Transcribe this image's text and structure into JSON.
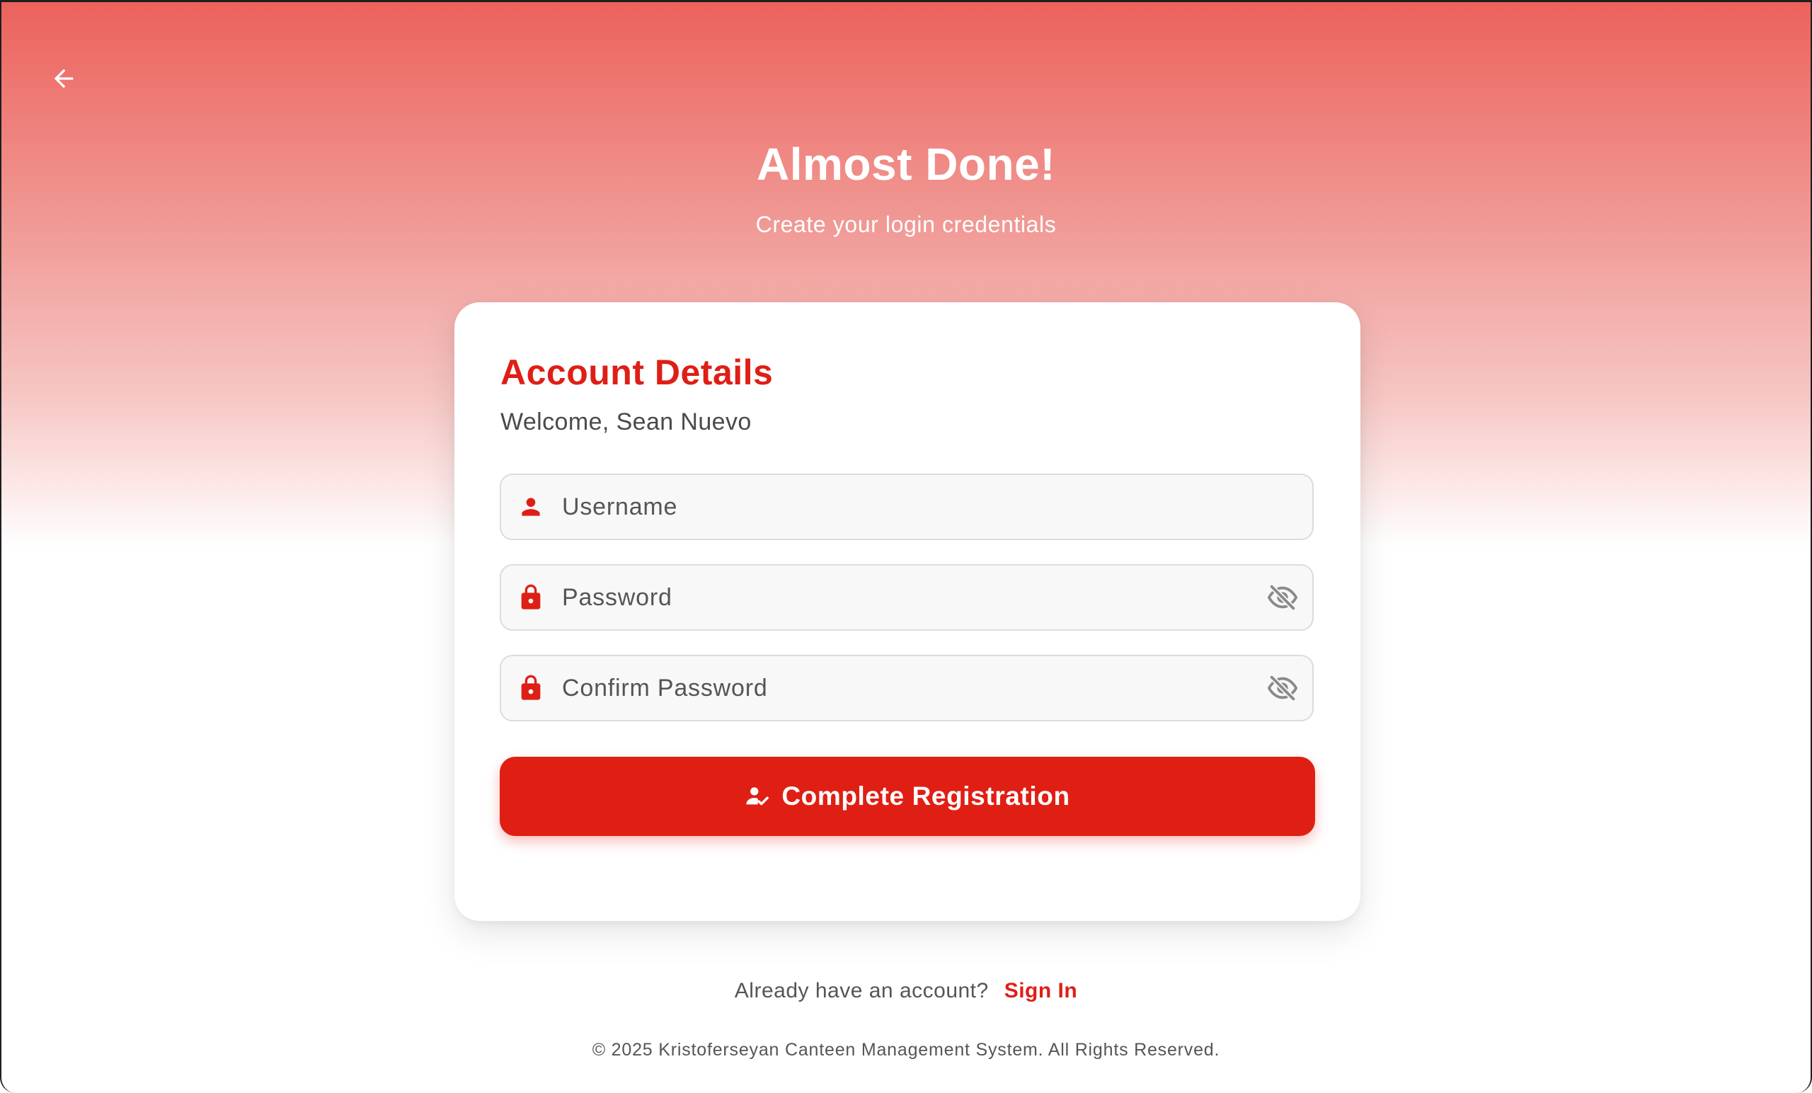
{
  "hero": {
    "title": "Almost Done!",
    "subtitle": "Create your login credentials"
  },
  "card": {
    "title": "Account Details",
    "welcome": "Welcome, Sean Nuevo"
  },
  "form": {
    "username": {
      "placeholder": "Username",
      "value": "",
      "icon": "user-icon"
    },
    "password": {
      "placeholder": "Password",
      "value": "",
      "icon": "lock-icon",
      "toggle_icon": "eye-off-icon"
    },
    "confirm_password": {
      "placeholder": "Confirm Password",
      "value": "",
      "icon": "lock-icon",
      "toggle_icon": "eye-off-icon"
    }
  },
  "submit": {
    "label": "Complete Registration",
    "icon": "user-check-icon"
  },
  "signin": {
    "prompt": "Already have an account?",
    "link_label": "Sign In"
  },
  "footer": {
    "copyright": "© 2025 Kristoferseyan Canteen Management System. All Rights Reserved."
  },
  "colors": {
    "accent": "#e01f14",
    "gradient_top": "#ec625c",
    "icon_gray": "#8a8a8a"
  }
}
